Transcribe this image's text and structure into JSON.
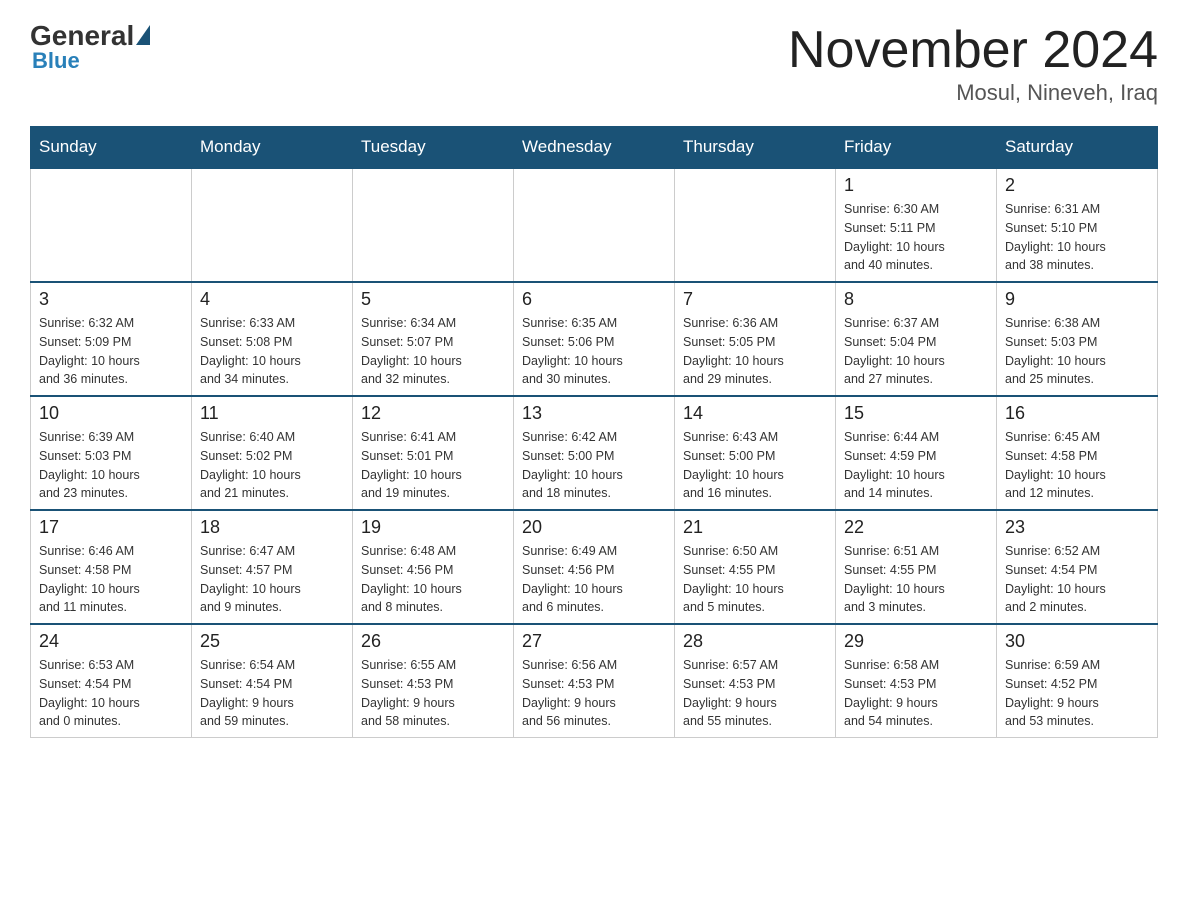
{
  "header": {
    "logo_general": "General",
    "logo_blue": "Blue",
    "month_title": "November 2024",
    "location": "Mosul, Nineveh, Iraq"
  },
  "weekdays": [
    "Sunday",
    "Monday",
    "Tuesday",
    "Wednesday",
    "Thursday",
    "Friday",
    "Saturday"
  ],
  "weeks": [
    [
      {
        "day": "",
        "info": ""
      },
      {
        "day": "",
        "info": ""
      },
      {
        "day": "",
        "info": ""
      },
      {
        "day": "",
        "info": ""
      },
      {
        "day": "",
        "info": ""
      },
      {
        "day": "1",
        "info": "Sunrise: 6:30 AM\nSunset: 5:11 PM\nDaylight: 10 hours\nand 40 minutes."
      },
      {
        "day": "2",
        "info": "Sunrise: 6:31 AM\nSunset: 5:10 PM\nDaylight: 10 hours\nand 38 minutes."
      }
    ],
    [
      {
        "day": "3",
        "info": "Sunrise: 6:32 AM\nSunset: 5:09 PM\nDaylight: 10 hours\nand 36 minutes."
      },
      {
        "day": "4",
        "info": "Sunrise: 6:33 AM\nSunset: 5:08 PM\nDaylight: 10 hours\nand 34 minutes."
      },
      {
        "day": "5",
        "info": "Sunrise: 6:34 AM\nSunset: 5:07 PM\nDaylight: 10 hours\nand 32 minutes."
      },
      {
        "day": "6",
        "info": "Sunrise: 6:35 AM\nSunset: 5:06 PM\nDaylight: 10 hours\nand 30 minutes."
      },
      {
        "day": "7",
        "info": "Sunrise: 6:36 AM\nSunset: 5:05 PM\nDaylight: 10 hours\nand 29 minutes."
      },
      {
        "day": "8",
        "info": "Sunrise: 6:37 AM\nSunset: 5:04 PM\nDaylight: 10 hours\nand 27 minutes."
      },
      {
        "day": "9",
        "info": "Sunrise: 6:38 AM\nSunset: 5:03 PM\nDaylight: 10 hours\nand 25 minutes."
      }
    ],
    [
      {
        "day": "10",
        "info": "Sunrise: 6:39 AM\nSunset: 5:03 PM\nDaylight: 10 hours\nand 23 minutes."
      },
      {
        "day": "11",
        "info": "Sunrise: 6:40 AM\nSunset: 5:02 PM\nDaylight: 10 hours\nand 21 minutes."
      },
      {
        "day": "12",
        "info": "Sunrise: 6:41 AM\nSunset: 5:01 PM\nDaylight: 10 hours\nand 19 minutes."
      },
      {
        "day": "13",
        "info": "Sunrise: 6:42 AM\nSunset: 5:00 PM\nDaylight: 10 hours\nand 18 minutes."
      },
      {
        "day": "14",
        "info": "Sunrise: 6:43 AM\nSunset: 5:00 PM\nDaylight: 10 hours\nand 16 minutes."
      },
      {
        "day": "15",
        "info": "Sunrise: 6:44 AM\nSunset: 4:59 PM\nDaylight: 10 hours\nand 14 minutes."
      },
      {
        "day": "16",
        "info": "Sunrise: 6:45 AM\nSunset: 4:58 PM\nDaylight: 10 hours\nand 12 minutes."
      }
    ],
    [
      {
        "day": "17",
        "info": "Sunrise: 6:46 AM\nSunset: 4:58 PM\nDaylight: 10 hours\nand 11 minutes."
      },
      {
        "day": "18",
        "info": "Sunrise: 6:47 AM\nSunset: 4:57 PM\nDaylight: 10 hours\nand 9 minutes."
      },
      {
        "day": "19",
        "info": "Sunrise: 6:48 AM\nSunset: 4:56 PM\nDaylight: 10 hours\nand 8 minutes."
      },
      {
        "day": "20",
        "info": "Sunrise: 6:49 AM\nSunset: 4:56 PM\nDaylight: 10 hours\nand 6 minutes."
      },
      {
        "day": "21",
        "info": "Sunrise: 6:50 AM\nSunset: 4:55 PM\nDaylight: 10 hours\nand 5 minutes."
      },
      {
        "day": "22",
        "info": "Sunrise: 6:51 AM\nSunset: 4:55 PM\nDaylight: 10 hours\nand 3 minutes."
      },
      {
        "day": "23",
        "info": "Sunrise: 6:52 AM\nSunset: 4:54 PM\nDaylight: 10 hours\nand 2 minutes."
      }
    ],
    [
      {
        "day": "24",
        "info": "Sunrise: 6:53 AM\nSunset: 4:54 PM\nDaylight: 10 hours\nand 0 minutes."
      },
      {
        "day": "25",
        "info": "Sunrise: 6:54 AM\nSunset: 4:54 PM\nDaylight: 9 hours\nand 59 minutes."
      },
      {
        "day": "26",
        "info": "Sunrise: 6:55 AM\nSunset: 4:53 PM\nDaylight: 9 hours\nand 58 minutes."
      },
      {
        "day": "27",
        "info": "Sunrise: 6:56 AM\nSunset: 4:53 PM\nDaylight: 9 hours\nand 56 minutes."
      },
      {
        "day": "28",
        "info": "Sunrise: 6:57 AM\nSunset: 4:53 PM\nDaylight: 9 hours\nand 55 minutes."
      },
      {
        "day": "29",
        "info": "Sunrise: 6:58 AM\nSunset: 4:53 PM\nDaylight: 9 hours\nand 54 minutes."
      },
      {
        "day": "30",
        "info": "Sunrise: 6:59 AM\nSunset: 4:52 PM\nDaylight: 9 hours\nand 53 minutes."
      }
    ]
  ]
}
